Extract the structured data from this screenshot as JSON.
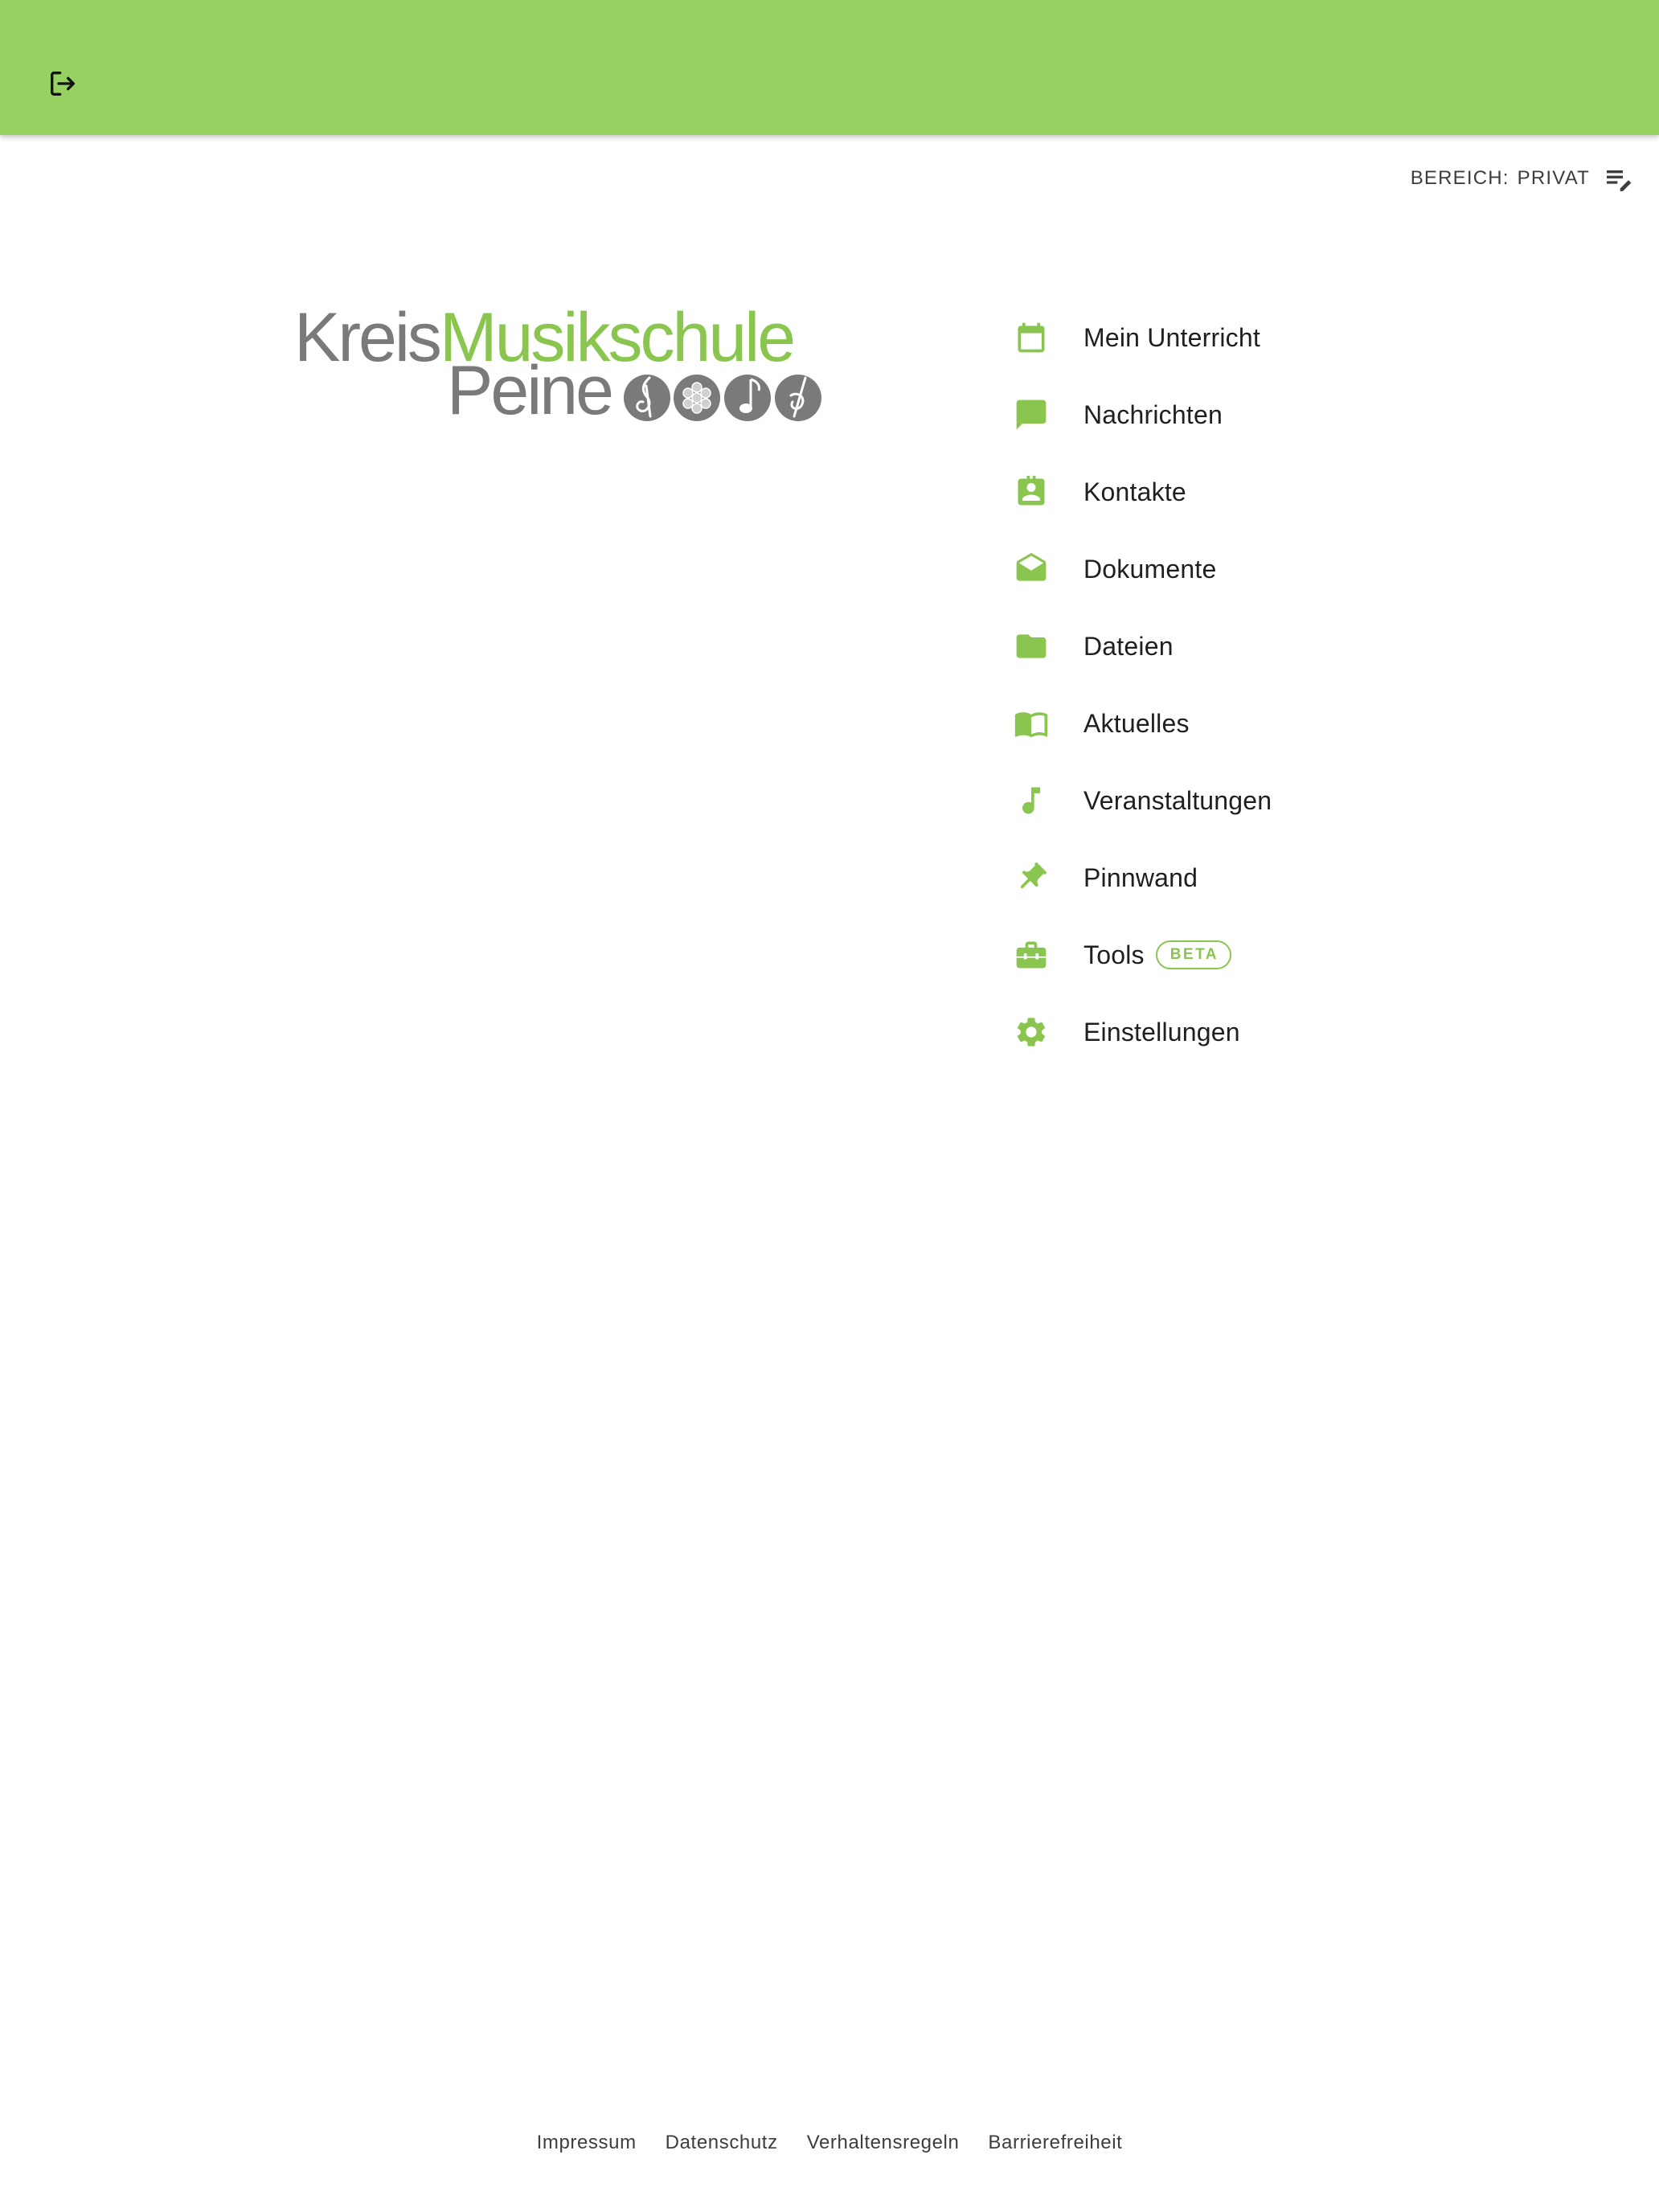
{
  "app_bar": {
    "color": "#97d161",
    "logout_icon": "logout-icon"
  },
  "area_switch": {
    "prefix": "BEREICH:",
    "value": "PRIVAT",
    "icon": "edit-list-icon"
  },
  "logo": {
    "line1_part1": "Kreis",
    "line1_part2": "Musikschule",
    "line2": "Peine",
    "gray": "#7a7a7a",
    "green": "#8ac64f"
  },
  "menu": {
    "accent": "#8ac64f",
    "items": [
      {
        "label": "Mein Unterricht",
        "icon": "calendar-icon"
      },
      {
        "label": "Nachrichten",
        "icon": "chat-bubble-icon"
      },
      {
        "label": "Kontakte",
        "icon": "contact-card-icon"
      },
      {
        "label": "Dokumente",
        "icon": "open-envelope-icon"
      },
      {
        "label": "Dateien",
        "icon": "folder-icon"
      },
      {
        "label": "Aktuelles",
        "icon": "open-book-icon"
      },
      {
        "label": "Veranstaltungen",
        "icon": "music-note-icon"
      },
      {
        "label": "Pinnwand",
        "icon": "pushpin-icon"
      },
      {
        "label": "Tools",
        "icon": "toolbox-icon",
        "badge": "BETA"
      },
      {
        "label": "Einstellungen",
        "icon": "gear-icon"
      }
    ]
  },
  "footer": {
    "links": [
      "Impressum",
      "Datenschutz",
      "Verhaltensregeln",
      "Barrierefreiheit"
    ]
  }
}
